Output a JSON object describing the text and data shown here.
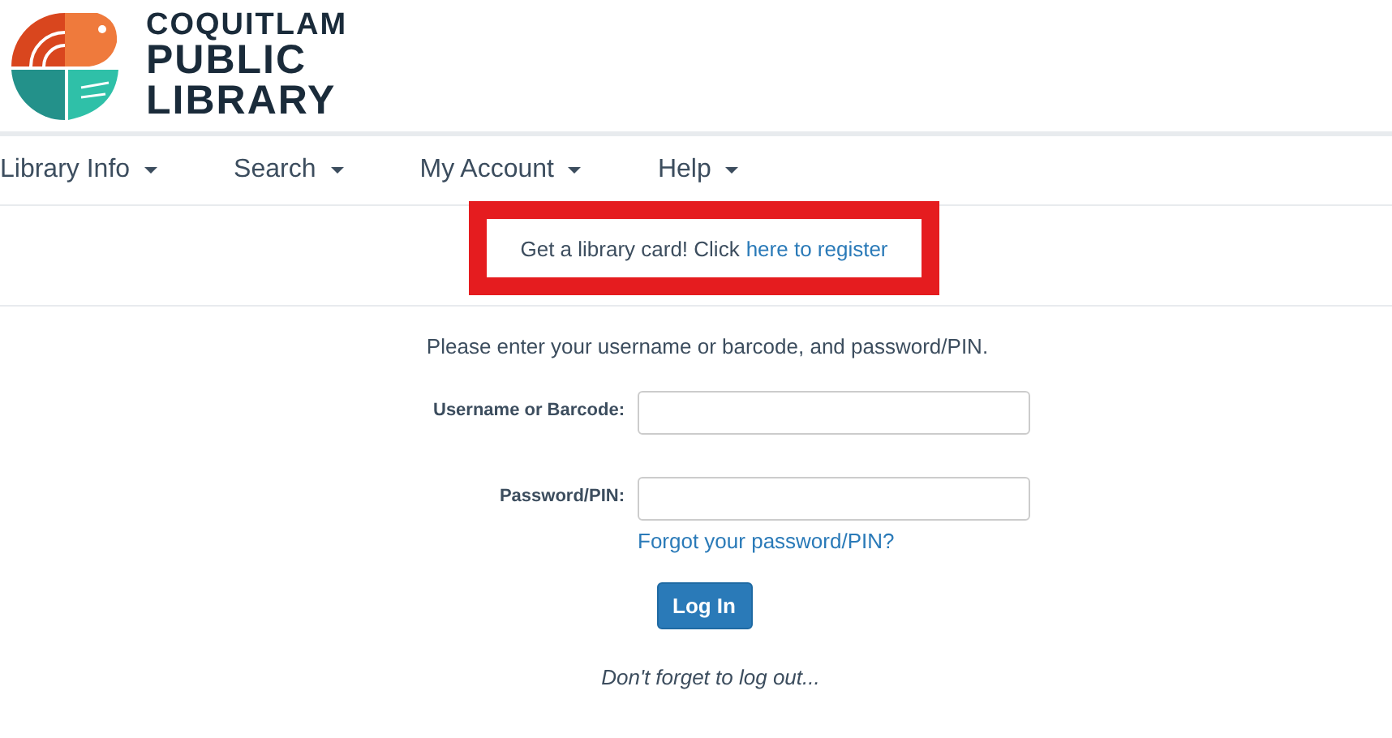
{
  "logo": {
    "lines": [
      "COQUITLAM",
      "PUBLIC",
      "LIBRARY"
    ]
  },
  "nav": [
    {
      "label": "Library Info"
    },
    {
      "label": "Search"
    },
    {
      "label": "My Account"
    },
    {
      "label": "Help"
    }
  ],
  "banner": {
    "text": "Get a library card! Click",
    "link": "here to register",
    "highlighted": true
  },
  "login": {
    "intro": "Please enter your username or barcode, and password/PIN.",
    "fields": [
      {
        "label": "Username or Barcode:"
      },
      {
        "label": "Password/PIN:",
        "link": "Forgot your password/PIN?"
      }
    ],
    "button": "Log In",
    "note": "Don't forget to log out..."
  }
}
